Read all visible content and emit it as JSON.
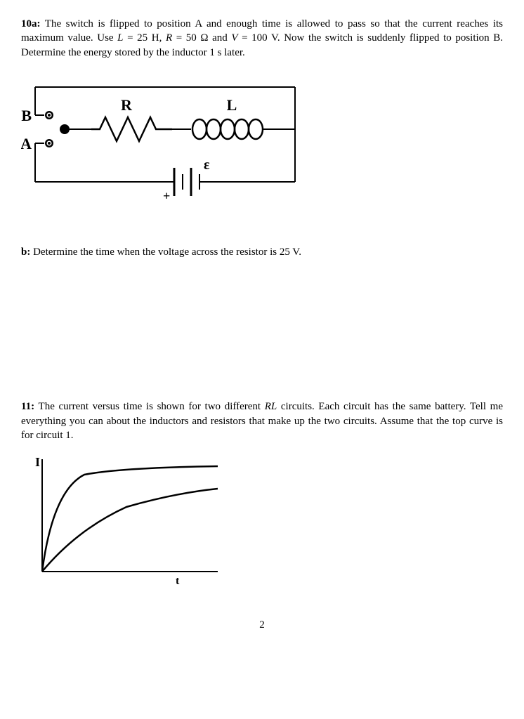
{
  "problem10a": {
    "label": "10a:",
    "text_part1": " The switch is flipped to position A and enough time is allowed to pass so that the current reaches its maximum value. Use ",
    "eq_L": "L",
    "eq_L_val": " = 25 H, ",
    "eq_R": "R",
    "eq_R_val": " = 50 Ω and ",
    "eq_V": "V",
    "eq_V_val": " = 100 V. Now the switch is suddenly flipped to position B. Determine the energy stored by the inductor 1 s later."
  },
  "circuit": {
    "label_B": "B",
    "label_A": "A",
    "label_R": "R",
    "label_L": "L",
    "label_eps": "ε",
    "label_plus": "+"
  },
  "problem_b": {
    "label": "b:",
    "text": " Determine the time when the voltage across the resistor is 25 V."
  },
  "problem11": {
    "label": "11:",
    "text_part1": " The current versus time is shown for two different ",
    "RL": "RL",
    "text_part2": " circuits. Each circuit has the same battery. Tell me everything you can about the inductors and resistors that make up the two circuits. Assume that the top curve is for circuit 1."
  },
  "graph": {
    "y_label": "I",
    "x_label": "t"
  },
  "page_number": "2"
}
